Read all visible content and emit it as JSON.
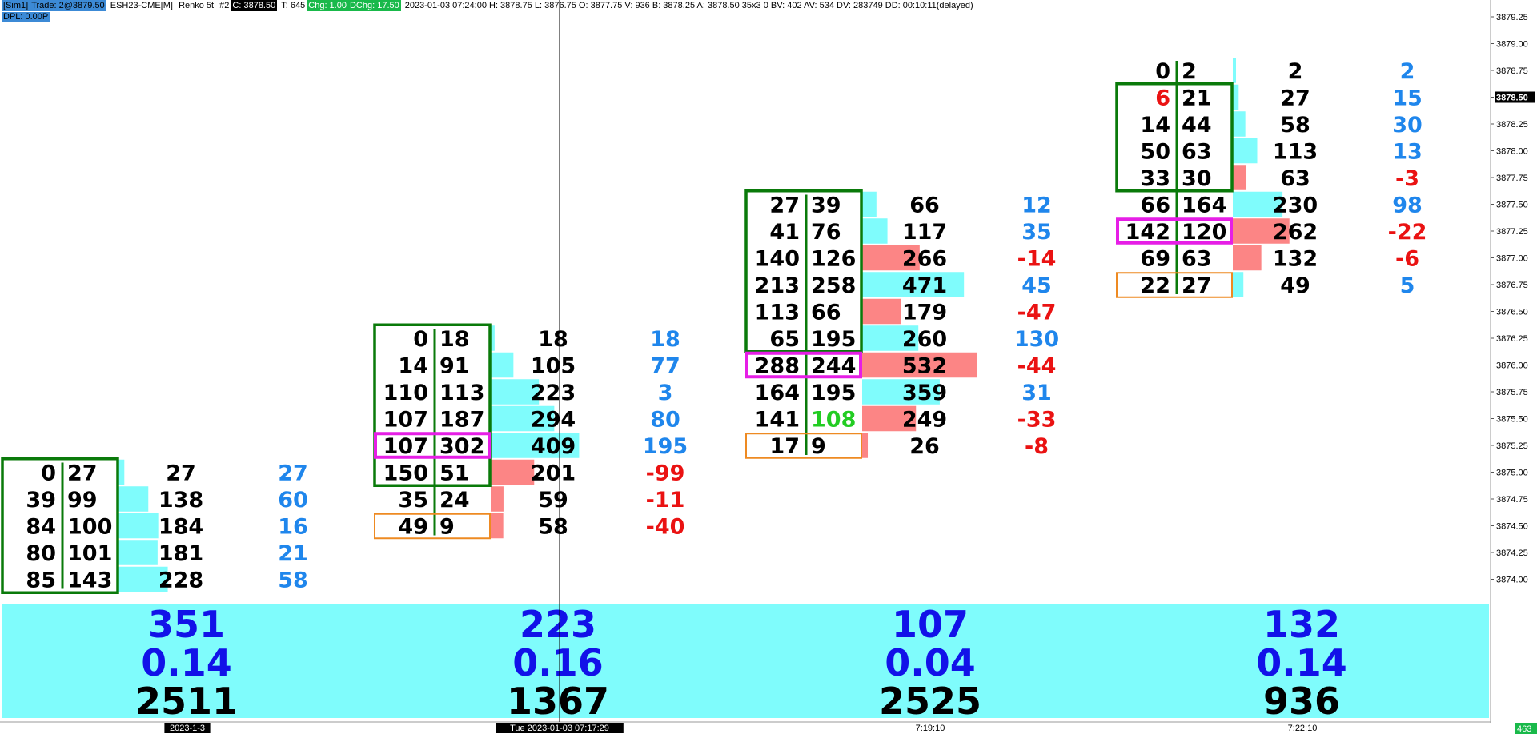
{
  "header": {
    "account": "[Sim1]",
    "last_trade": "Trade: 2@3879.50",
    "symbol": "ESH23-CME[M]",
    "bar_type": "Renko 5t",
    "chart_no": "#2",
    "close": "C: 3878.50",
    "ticks": "T: 645",
    "chg": "Chg: 1.00",
    "dchg": "DChg: 17.50",
    "info": "2023-01-03 07:24:00  H: 3878.75  L: 3876.75  O: 3877.75  V: 936  B: 3878.25  A: 3878.50  35x3  0  BV: 402  AV: 534  DV: 283749  DD: 00:10:11(delayed)",
    "dpl": "DPL: 0.00P"
  },
  "colors": {
    "ask_bar": "#7ffcfc",
    "bid_bar": "#fc8585",
    "value_area": "#0a7a0a",
    "poc": "#e61ee6",
    "bottom_box": "#ee8a22",
    "delta_pos": "#1f86ec",
    "delta_neg": "#ea1212",
    "summary_bg": "#7ffcfc",
    "summary_blue": "#1212e8",
    "cursor_price_bg": "#000000",
    "big_trade_green": "#22cc22"
  },
  "price_axis": {
    "ticks": [
      "3879.25",
      "3879.00",
      "3878.75",
      "3878.50",
      "3878.25",
      "3878.00",
      "3877.75",
      "3877.50",
      "3877.25",
      "3877.00",
      "3876.75",
      "3876.50",
      "3876.25",
      "3876.00",
      "3875.75",
      "3875.50",
      "3875.25",
      "3875.00",
      "3874.75",
      "3874.50",
      "3874.25",
      "3874.00"
    ],
    "current_price": "3878.50",
    "volume_badge": "463"
  },
  "time_axis": {
    "labels": [
      "2023-1-3",
      "Tue 2023-01-03  07:17:29",
      "7:19:10",
      "7:22:10"
    ],
    "cursor_label_index": 1
  },
  "chart_data": {
    "type": "footprint",
    "tick_size": 0.25,
    "bars": [
      {
        "high": 3875.0,
        "low": 3874.0,
        "rows": [
          {
            "bid": 0,
            "ask": 27,
            "vol": 27,
            "delta": 27
          },
          {
            "bid": 39,
            "ask": 99,
            "vol": 138,
            "delta": 60
          },
          {
            "bid": 84,
            "ask": 100,
            "vol": 184,
            "delta": 16
          },
          {
            "bid": 80,
            "ask": 101,
            "vol": 181,
            "delta": 21
          },
          {
            "bid": 85,
            "ask": 143,
            "vol": 228,
            "delta": 58
          }
        ],
        "poc_index": null,
        "va_top": 0,
        "va_bottom": 4,
        "close_index": null,
        "summary": {
          "delta": "351",
          "ratio": "0.14",
          "volume": "2511"
        }
      },
      {
        "high": 3876.25,
        "low": 3874.5,
        "rows": [
          {
            "bid": 0,
            "ask": 18,
            "vol": 18,
            "delta": 18
          },
          {
            "bid": 14,
            "ask": 91,
            "vol": 105,
            "delta": 77
          },
          {
            "bid": 110,
            "ask": 113,
            "vol": 223,
            "delta": 3
          },
          {
            "bid": 107,
            "ask": 187,
            "vol": 294,
            "delta": 80
          },
          {
            "bid": 107,
            "ask": 302,
            "vol": 409,
            "delta": 195
          },
          {
            "bid": 150,
            "ask": 51,
            "vol": 201,
            "delta": -99
          },
          {
            "bid": 35,
            "ask": 24,
            "vol": 59,
            "delta": -11
          },
          {
            "bid": 49,
            "ask": 9,
            "vol": 58,
            "delta": -40
          }
        ],
        "poc_index": 4,
        "va_top": 0,
        "va_bottom": 5,
        "close_index": 7,
        "summary": {
          "delta": "223",
          "ratio": "0.16",
          "volume": "1367"
        }
      },
      {
        "high": 3877.5,
        "low": 3875.25,
        "rows": [
          {
            "bid": 27,
            "ask": 39,
            "vol": 66,
            "delta": 12
          },
          {
            "bid": 41,
            "ask": 76,
            "vol": 117,
            "delta": 35
          },
          {
            "bid": 140,
            "ask": 126,
            "vol": 266,
            "delta": -14
          },
          {
            "bid": 213,
            "ask": 258,
            "vol": 471,
            "delta": 45
          },
          {
            "bid": 113,
            "ask": 66,
            "vol": 179,
            "delta": -47
          },
          {
            "bid": 65,
            "ask": 195,
            "vol": 260,
            "delta": 130
          },
          {
            "bid": 288,
            "ask": 244,
            "vol": 532,
            "delta": -44
          },
          {
            "bid": 164,
            "ask": 195,
            "vol": 359,
            "delta": 31
          },
          {
            "bid": 141,
            "ask": 108,
            "vol": 249,
            "delta": -33,
            "ask_highlight": true
          },
          {
            "bid": 17,
            "ask": 9,
            "vol": 26,
            "delta": -8
          }
        ],
        "poc_index": 6,
        "va_top": 0,
        "va_bottom": 5,
        "close_index": 9,
        "summary": {
          "delta": "107",
          "ratio": "0.04",
          "volume": "2525"
        }
      },
      {
        "high": 3878.75,
        "low": 3876.75,
        "rows": [
          {
            "bid": 0,
            "ask": 2,
            "vol": 2,
            "delta": 2
          },
          {
            "bid": 6,
            "ask": 21,
            "vol": 27,
            "delta": 15,
            "bid_highlight": true
          },
          {
            "bid": 14,
            "ask": 44,
            "vol": 58,
            "delta": 30
          },
          {
            "bid": 50,
            "ask": 63,
            "vol": 113,
            "delta": 13
          },
          {
            "bid": 33,
            "ask": 30,
            "vol": 63,
            "delta": -3
          },
          {
            "bid": 66,
            "ask": 164,
            "vol": 230,
            "delta": 98
          },
          {
            "bid": 142,
            "ask": 120,
            "vol": 262,
            "delta": -22
          },
          {
            "bid": 69,
            "ask": 63,
            "vol": 132,
            "delta": -6
          },
          {
            "bid": 22,
            "ask": 27,
            "vol": 49,
            "delta": 5
          }
        ],
        "poc_index": 6,
        "va_top": 1,
        "va_bottom": 4,
        "close_index": 8,
        "summary": {
          "delta": "132",
          "ratio": "0.14",
          "volume": "936"
        }
      }
    ]
  }
}
